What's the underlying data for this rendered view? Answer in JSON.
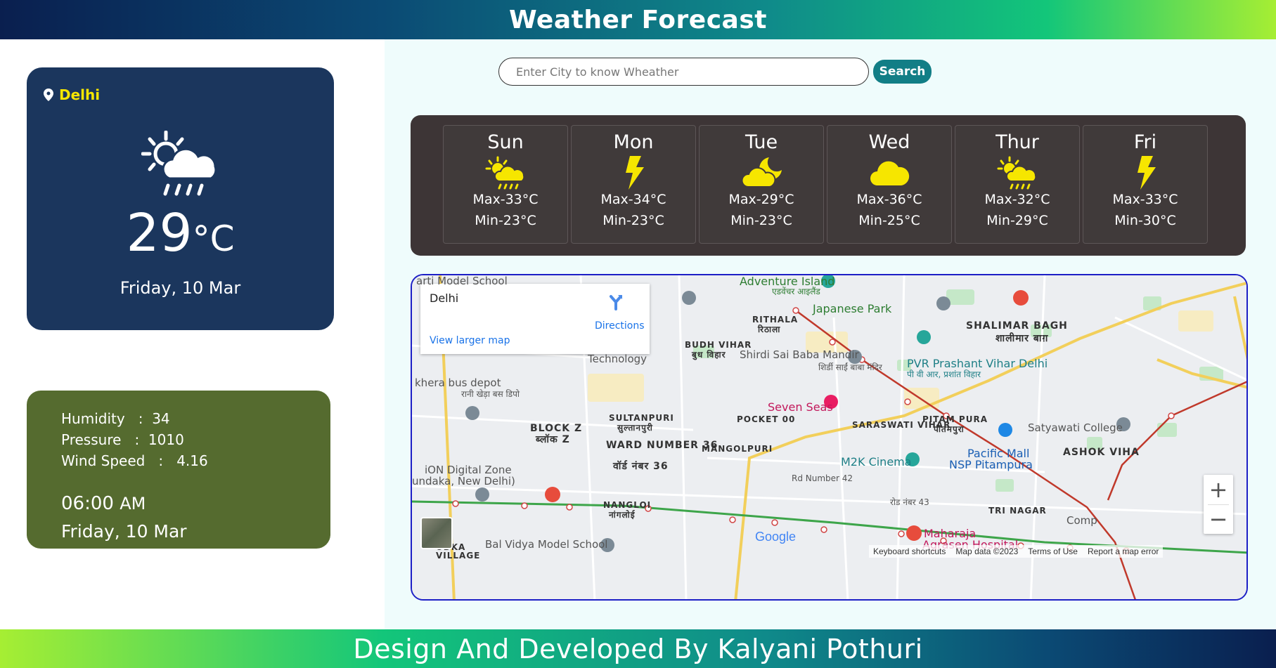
{
  "header": {
    "title": "Weather Forecast"
  },
  "current": {
    "location": "Delhi",
    "icon": "sun-cloud-rain-icon",
    "temperature": "29",
    "unit": "°C",
    "date": "Friday, 10 Mar"
  },
  "details": {
    "humidity": "Humidity   :  34",
    "pressure": "Pressure   :  1010",
    "wind_speed": "Wind Speed   :   4.16",
    "time": "06:00",
    "ampm": "AM",
    "date": "Friday, 10 Mar"
  },
  "search": {
    "placeholder": "Enter City to know Wheather",
    "value": "",
    "button_label": "Search"
  },
  "forecast": [
    {
      "day": "Sun",
      "icon": "sun-cloud-rain-icon",
      "max": "Max-33°C",
      "min": "Min-23°C"
    },
    {
      "day": "Mon",
      "icon": "lightning-icon",
      "max": "Max-34°C",
      "min": "Min-23°C"
    },
    {
      "day": "Tue",
      "icon": "moon-cloud-icon",
      "max": "Max-29°C",
      "min": "Min-23°C"
    },
    {
      "day": "Wed",
      "icon": "cloud-icon",
      "max": "Max-36°C",
      "min": "Min-25°C"
    },
    {
      "day": "Thur",
      "icon": "sun-cloud-rain-icon",
      "max": "Max-32°C",
      "min": "Min-29°C"
    },
    {
      "day": "Fri",
      "icon": "lightning-icon",
      "max": "Max-33°C",
      "min": "Min-30°C"
    }
  ],
  "map": {
    "place": "Delhi",
    "directions": "Directions",
    "view_larger": "View larger map",
    "labels": {
      "adventure_island": "Adventure Island",
      "adventure_island_hi": "एडवेंचर आइलैंड",
      "japanese_park": "Japanese Park",
      "shalimar_bagh": "SHALIMAR BAGH",
      "shalimar_bagh_hi": "शालीमार बाग़",
      "rithala": "RITHALA",
      "rithala_hi": "रिठाला",
      "budh_vihar": "BUDH VIHAR",
      "budh_vihar_hi": "बुध विहार",
      "shirdi": "Shirdi Sai Baba Mandir",
      "shirdi_hi": "शिर्डी साईं बाबा मंदिर",
      "pvr": "PVR Prashant Vihar Delhi",
      "pvr_hi": "पी वी आर, प्रशांत विहार",
      "technology": "Technology",
      "kherabus": "khera bus depot",
      "kherabus_hi": "रानी खेड़ा बस डिपो",
      "seven_seas": "Seven Seas",
      "pocket": "POCKET 00",
      "block_z": "BLOCK Z",
      "block_z_hi": "ब्लॉक Z",
      "sultanpuri": "SULTANPURI",
      "sultanpuri_hi": "सुल्तानपुरी",
      "saraswati": "SARASWATI VIHAR",
      "pitampura": "PITAM PURA",
      "pitampura_hi": "पीतमपुरा",
      "satyawati": "Satyawati College",
      "ward36": "WARD NUMBER 36",
      "ward36_hi": "वॉर्ड नंबर 36",
      "mangolpuri": "MANGOLPURI",
      "m2k": "M2K Cinema",
      "pacific": "Pacific Mall",
      "nsp": "NSP Pitampura",
      "ashok": "ASHOK VIHA",
      "ion": "iON Digital Zone",
      "mundka": "undaka, New Delhi)",
      "rd42": "Rd Number 42",
      "rd43": "रोड नंबर 43",
      "tri_nagar": "TRI NAGAR",
      "nangloi": "NANGLOI",
      "nangloi_hi": "नांगलोई",
      "bal_vidya": "Bal Vidya Model School",
      "arti": "arti Model School",
      "maharaja": "Maharaja",
      "agrasen": "Agrasen Hospital",
      "udka": "UDKA",
      "village": "VILLAGE",
      "comp": "Comp"
    },
    "google": "Google",
    "footer": {
      "shortcuts": "Keyboard shortcuts",
      "map_data": "Map data ©2023",
      "terms": "Terms of Use",
      "report": "Report a map error"
    },
    "zoom_in": "+",
    "zoom_out": "−"
  },
  "footer": {
    "text": "Design And Developed By Kalyani Pothuri"
  },
  "colors": {
    "current_card": "#1b365d",
    "details_card": "#556b2f",
    "forecast_panel": "#3d3536",
    "accent_yellow": "#f6e600",
    "search_button": "#127e86"
  }
}
